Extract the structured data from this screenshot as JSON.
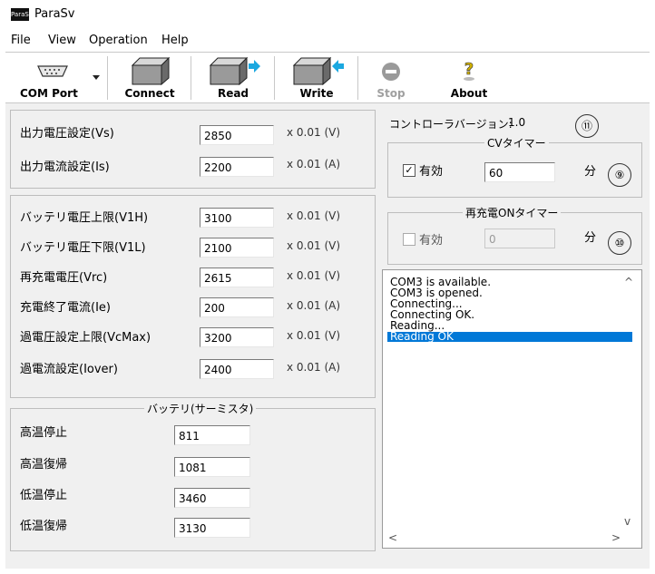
{
  "window": {
    "title": "ParaSv",
    "icon_text": "ParaSv"
  },
  "menu": [
    "File",
    "View",
    "Operation",
    "Help"
  ],
  "toolbar": {
    "com_port": "COM Port",
    "connect": "Connect",
    "read": "Read",
    "write": "Write",
    "stop": "Stop",
    "about": "About"
  },
  "output": {
    "voltage": {
      "label": "出力電圧設定(Vs)",
      "value": "2850",
      "unit": "x 0.01 (V)"
    },
    "current": {
      "label": "出力電流設定(Is)",
      "value": "2200",
      "unit": "x 0.01 (A)"
    }
  },
  "battery": {
    "rows": [
      {
        "label": "バッテリ電圧上限(V1H)",
        "value": "3100",
        "unit": "x 0.01 (V)"
      },
      {
        "label": "バッテリ電圧下限(V1L)",
        "value": "2100",
        "unit": "x 0.01 (V)"
      },
      {
        "label": "再充電電圧(Vrc)",
        "value": "2615",
        "unit": "x 0.01 (V)"
      },
      {
        "label": "充電終了電流(Ie)",
        "value": "200",
        "unit": "x 0.01 (A)"
      },
      {
        "label": "過電圧設定上限(VcMax)",
        "value": "3200",
        "unit": "x 0.01 (V)"
      },
      {
        "label": "過電流設定(Iover)",
        "value": "2400",
        "unit": "x 0.01 (A)"
      }
    ]
  },
  "thermistor": {
    "title": "バッテリ(サーミスタ)",
    "rows": [
      {
        "label": "高温停止",
        "value": "811"
      },
      {
        "label": "高温復帰",
        "value": "1081"
      },
      {
        "label": "低温停止",
        "value": "3460"
      },
      {
        "label": "低温復帰",
        "value": "3130"
      }
    ]
  },
  "version": {
    "label": "コントローラバージョン:",
    "value": "1.0",
    "marker": "⑪"
  },
  "cv_timer": {
    "title": "CVタイマー",
    "enabled_label": "有効",
    "checked": true,
    "value": "60",
    "unit": "分",
    "marker": "⑨"
  },
  "recharge_timer": {
    "title": "再充電ONタイマー",
    "enabled_label": "有効",
    "checked": false,
    "value": "0",
    "unit": "分",
    "marker": "⑩"
  },
  "log": {
    "lines": [
      "COM3 is available.",
      "COM3 is opened.",
      "Connecting...",
      "Connecting OK.",
      "Reading...",
      "Reading OK"
    ],
    "selected": 5
  },
  "icons": {
    "check_mark": "✓",
    "scroll_up": "^",
    "scroll_down": "v",
    "scroll_left": "<",
    "scroll_right": ">"
  }
}
